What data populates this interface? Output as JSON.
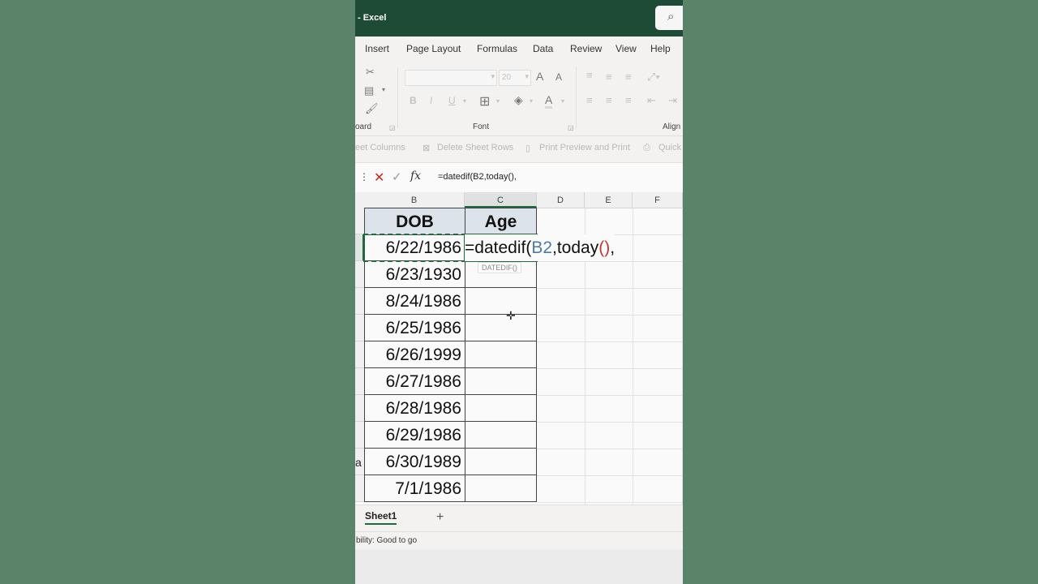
{
  "app": {
    "title": "- Excel",
    "search_icon": "⌕"
  },
  "tabs": [
    "Insert",
    "Page Layout",
    "Formulas",
    "Data",
    "Review",
    "View",
    "Help"
  ],
  "ribbon": {
    "clipboard_label": "oard",
    "font_label": "Font",
    "align_label": "Align",
    "font_size": "20",
    "bold": "B",
    "italic": "I",
    "underline": "U",
    "grow": "A",
    "shrink": "A",
    "fontcolor": "A"
  },
  "quick_access": [
    "eet Columns",
    "Delete Sheet Rows",
    "Print Preview and Print",
    "Quick"
  ],
  "formula_bar": {
    "formula": "=datedif(B2,today(),"
  },
  "columns": [
    "B",
    "C",
    "D",
    "E",
    "F"
  ],
  "table": {
    "headers": [
      "DOB",
      "Age"
    ],
    "dates": [
      "6/22/1986",
      "6/23/1930",
      "8/24/1986",
      "6/25/1986",
      "6/26/1999",
      "6/27/1986",
      "6/28/1986",
      "6/29/1986",
      "6/30/1989",
      "7/1/1986"
    ]
  },
  "editing": {
    "prefix": "=datedif(",
    "ref": "B2",
    "mid": ",today",
    "paren": "()",
    "suffix": ","
  },
  "tooltip": "DATEDIF()",
  "row_clip": "a",
  "sheets": [
    {
      "name": "Sheet1"
    }
  ],
  "add_sheet": "+",
  "status": "bility: Good to go"
}
